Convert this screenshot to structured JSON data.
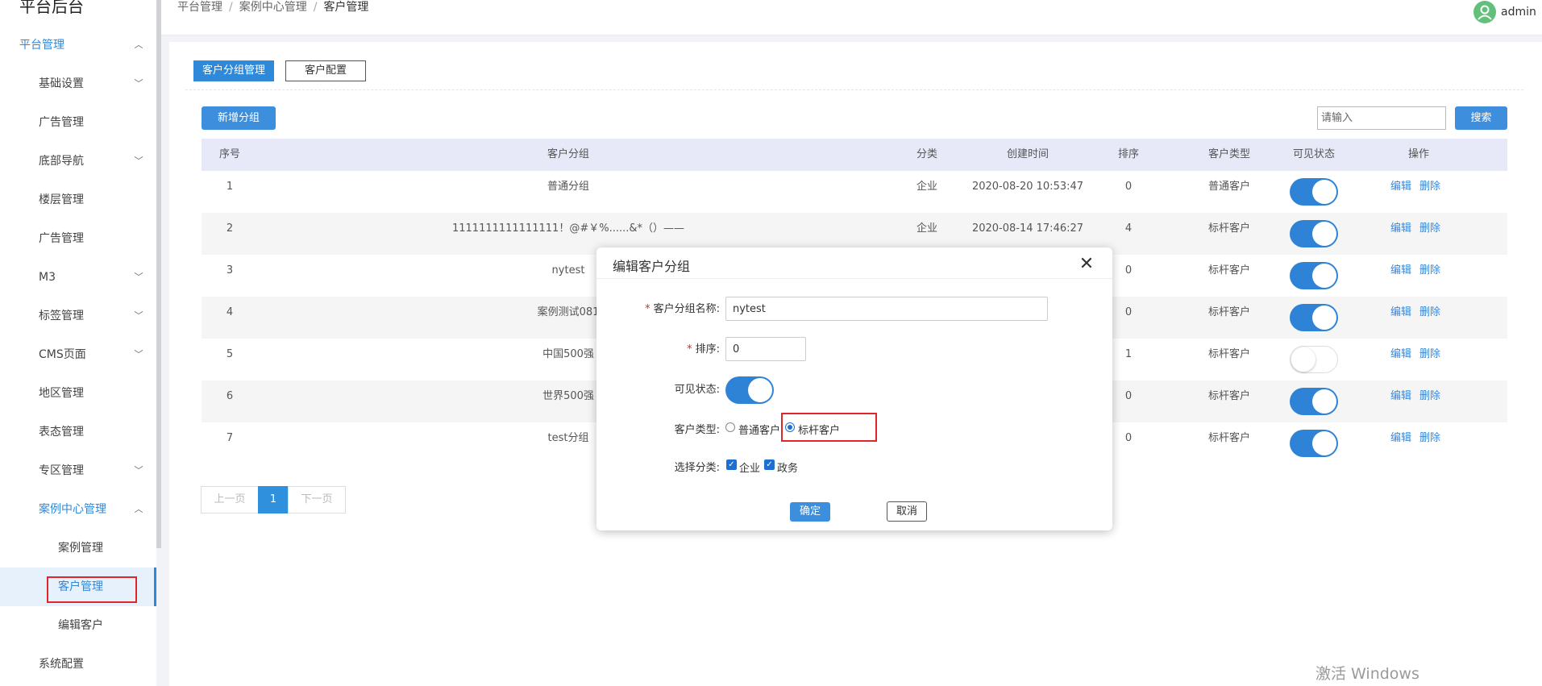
{
  "sidebar": {
    "app_title": "平台后台",
    "items": [
      {
        "label": "平台管理",
        "chevron": "^"
      },
      {
        "label": "基础设置",
        "chevron": "v"
      },
      {
        "label": "广告管理",
        "chevron": ""
      },
      {
        "label": "底部导航",
        "chevron": "v"
      },
      {
        "label": "楼层管理",
        "chevron": ""
      },
      {
        "label": "广告管理",
        "chevron": ""
      },
      {
        "label": "M3",
        "chevron": "v"
      },
      {
        "label": "标签管理",
        "chevron": "v"
      },
      {
        "label": "CMS页面",
        "chevron": "v"
      },
      {
        "label": "地区管理",
        "chevron": ""
      },
      {
        "label": "表态管理",
        "chevron": ""
      },
      {
        "label": "专区管理",
        "chevron": "v"
      },
      {
        "label": "案例中心管理",
        "chevron": "^"
      },
      {
        "label": "案例管理",
        "chevron": ""
      },
      {
        "label": "客户管理",
        "chevron": ""
      },
      {
        "label": "编辑客户",
        "chevron": ""
      },
      {
        "label": "系统配置",
        "chevron": ""
      }
    ]
  },
  "header": {
    "breadcrumb": [
      "平台管理",
      "案例中心管理",
      "客户管理"
    ],
    "username": "admin"
  },
  "tabs": [
    "客户分组管理",
    "客户配置"
  ],
  "toolbar": {
    "add_label": "新增分组",
    "search_placeholder": "请输入",
    "search_label": "搜索"
  },
  "table": {
    "columns": [
      "序号",
      "客户分组",
      "分类",
      "创建时间",
      "排序",
      "客户类型",
      "可见状态",
      "操作"
    ],
    "rows": [
      {
        "no": "1",
        "group": "普通分组",
        "category": "企业",
        "created": "2020-08-20 10:53:47",
        "sort": "0",
        "type": "普通客户",
        "visible": true
      },
      {
        "no": "2",
        "group": "1111111111111111！@#￥%......&*（）——",
        "category": "企业",
        "created": "2020-08-14 17:46:27",
        "sort": "4",
        "type": "标杆客户",
        "visible": true
      },
      {
        "no": "3",
        "group": "nytest",
        "category": "",
        "created": "",
        "sort": "0",
        "type": "标杆客户",
        "visible": true
      },
      {
        "no": "4",
        "group": "案例测试081",
        "category": "",
        "created": "",
        "sort": "0",
        "type": "标杆客户",
        "visible": true
      },
      {
        "no": "5",
        "group": "中国500强",
        "category": "",
        "created": "",
        "sort": "1",
        "type": "标杆客户",
        "visible": false
      },
      {
        "no": "6",
        "group": "世界500强",
        "category": "",
        "created": "",
        "sort": "0",
        "type": "标杆客户",
        "visible": true
      },
      {
        "no": "7",
        "group": "test分组",
        "category": "",
        "created": "",
        "sort": "0",
        "type": "标杆客户",
        "visible": true
      }
    ],
    "edit_label": "编辑",
    "delete_label": "删除"
  },
  "pagination": {
    "prev": "上一页",
    "current": "1",
    "next": "下一页"
  },
  "modal": {
    "title": "编辑客户分组",
    "close_icon": "close-icon",
    "name_label": "客户分组名称:",
    "name_value": "nytest",
    "sort_label": "排序:",
    "sort_value": "0",
    "visible_label": "可见状态:",
    "visible_on": true,
    "type_label": "客户类型:",
    "type_options": [
      "普通客户",
      "标杆客户"
    ],
    "type_selected": "标杆客户",
    "category_label": "选择分类:",
    "category_options": [
      "企业",
      "政务"
    ],
    "category_checked": [
      "企业",
      "政务"
    ],
    "ok_label": "确定",
    "cancel_label": "取消"
  },
  "watermark": "激活 Windows",
  "colors": {
    "accent": "#3088d9",
    "toggle_on": "#2f83d6",
    "highlight_box": "#e0262b"
  }
}
